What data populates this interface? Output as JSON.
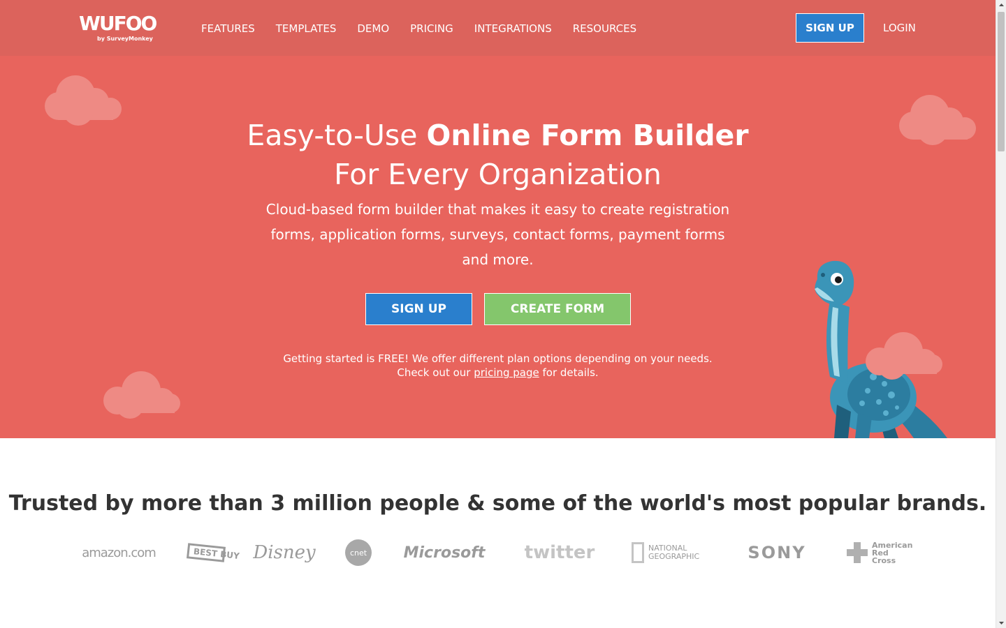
{
  "header": {
    "logo_text": "WUFOO",
    "logo_sub": "by SurveyMonkey",
    "nav": [
      "FEATURES",
      "TEMPLATES",
      "DEMO",
      "PRICING",
      "INTEGRATIONS",
      "RESOURCES"
    ],
    "signup_label": "SIGN UP",
    "login_label": "LOGIN"
  },
  "hero": {
    "title_light": "Easy-to-Use ",
    "title_bold": "Online Form Builder",
    "title_line2": "For Every Organization",
    "subtitle": "Cloud-based form builder that makes it easy to create registration forms, application forms, surveys, contact forms, payment forms and more.",
    "signup_label": "SIGN UP",
    "create_form_label": "CREATE FORM",
    "note_before": "Getting started is FREE! We offer different plan options depending on your needs. Check out our ",
    "note_link": "pricing page",
    "note_after": " for details."
  },
  "trusted": {
    "title": "Trusted by more than 3 million people & some of the world's most popular brands.",
    "brands": [
      "amazon.com",
      "BEST BUY",
      "Disney",
      "cnet",
      "Microsoft",
      "twitter",
      "NATIONAL GEOGRAPHIC",
      "SONY",
      "American Red Cross"
    ]
  },
  "colors": {
    "header_bg": "#dc635c",
    "hero_bg": "#e8645d",
    "primary_blue": "#2a7fcd",
    "create_green": "#84c66c",
    "brand_gray": "#9a9a9a"
  }
}
